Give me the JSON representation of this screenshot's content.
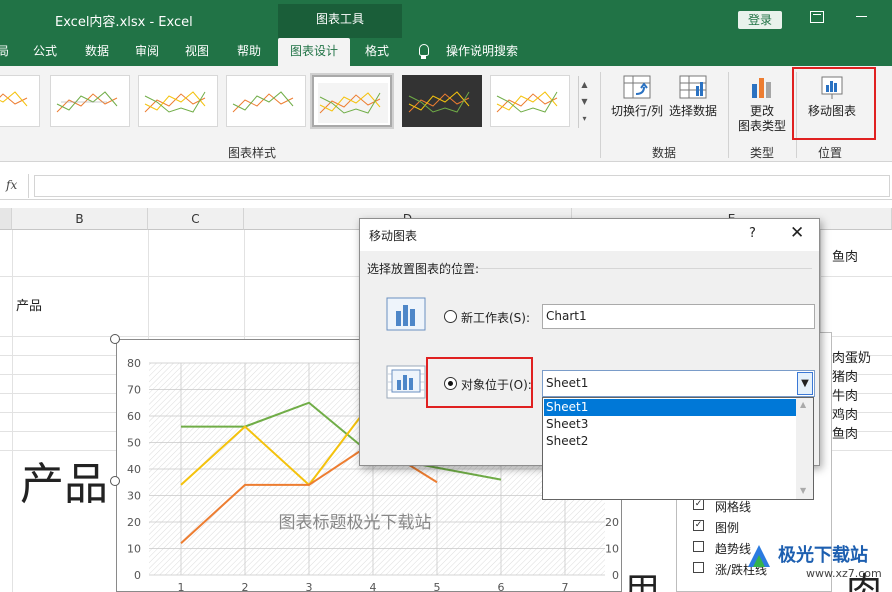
{
  "titlebar": {
    "doc_title": "Excel内容.xlsx  -  Excel",
    "tools_tab": "图表工具",
    "login": "登录"
  },
  "tabs": [
    "局",
    "公式",
    "数据",
    "审阅",
    "视图",
    "帮助",
    "图表设计",
    "格式"
  ],
  "active_tab": "图表设计",
  "tell_me": "操作说明搜索",
  "ribbon": {
    "chart_styles_group": "图表样式",
    "data_group": "数据",
    "type_group": "类型",
    "location_group": "位置",
    "switch_row_col": "切换行/列",
    "select_data": "选择数据",
    "change_type_1": "更改",
    "change_type_2": "图表类型",
    "move_chart": "移动图表",
    "thumb_title": "图表标题极光下载站"
  },
  "formula_bar": {
    "fx": "fx"
  },
  "grid": {
    "columns": [
      "B",
      "C",
      "D",
      "E"
    ],
    "cells": {
      "product": "产品",
      "product_large": "产品",
      "fish": "鱼肉",
      "meat_items": [
        "肉蛋奶",
        "猪肉",
        "牛肉",
        "鸡肉",
        "鱼肉"
      ],
      "bottom_char_1": "用",
      "bottom_char_2": "肉"
    }
  },
  "chart": {
    "title": "图表标题极光下载站"
  },
  "chart_data": {
    "type": "line",
    "title": "图表标题极光下载站",
    "x": [
      1,
      2,
      3,
      4,
      5,
      6,
      7
    ],
    "ylim": [
      0,
      80
    ],
    "yticks": [
      0,
      10,
      20,
      30,
      40,
      50,
      60,
      70,
      80
    ],
    "secondary_yticks": [
      0,
      10,
      20
    ],
    "grid": true,
    "series": [
      {
        "color": "#70ad47",
        "values": [
          56,
          56,
          65,
          45,
          null,
          36,
          null
        ]
      },
      {
        "color": "#f4c20d",
        "values": [
          34,
          56,
          34,
          66,
          null,
          null,
          null
        ]
      },
      {
        "color": "#ed7d31",
        "values": [
          12,
          34,
          34,
          50,
          35,
          null,
          null
        ]
      }
    ]
  },
  "chart_elements": [
    {
      "label": "网格线",
      "checked": true
    },
    {
      "label": "图例",
      "checked": true
    },
    {
      "label": "趋势线",
      "checked": false
    },
    {
      "label": "涨/跌柱线",
      "checked": false
    }
  ],
  "dialog": {
    "title": "移动图表",
    "help": "?",
    "close": "✕",
    "prompt": "选择放置图表的位置:",
    "new_sheet_label": "新工作表(S):",
    "new_sheet_value": "Chart1",
    "object_in_label": "对象位于(O):",
    "object_in_value": "Sheet1",
    "options": [
      "Sheet1",
      "Sheet3",
      "Sheet2"
    ],
    "selected_option": "Sheet1"
  },
  "watermark": {
    "name": "极光下载站",
    "url": "www.xz7.com"
  },
  "colors": {
    "excel_green": "#217346",
    "highlight_red": "#e02020",
    "selection_blue": "#0078d7"
  }
}
